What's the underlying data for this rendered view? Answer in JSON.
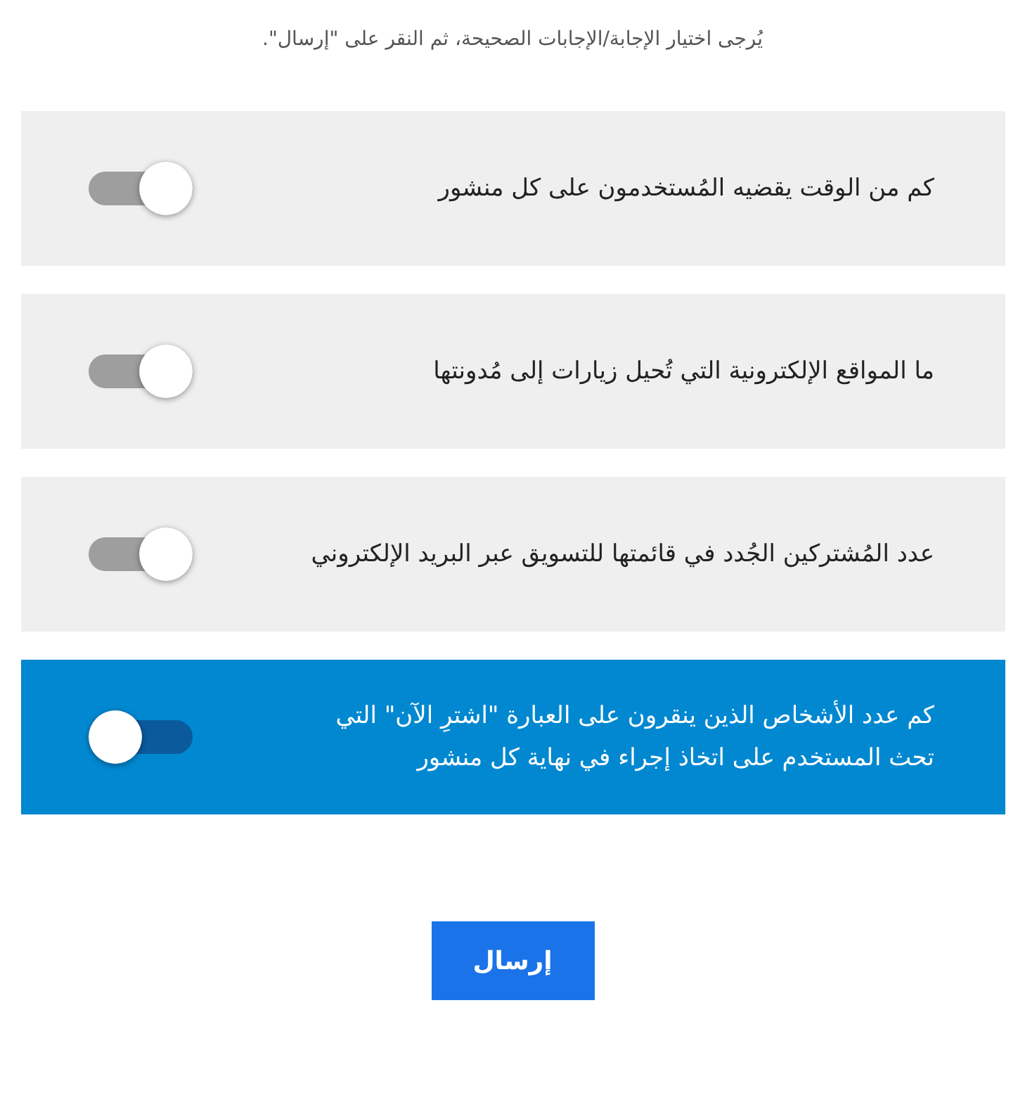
{
  "instruction": "يُرجى اختيار الإجابة/الإجابات الصحيحة، ثم النقر على \"إرسال\".",
  "options": [
    {
      "label": "كم من الوقت يقضيه المُستخدمون على كل منشور",
      "selected": false
    },
    {
      "label": "ما المواقع الإلكترونية التي تُحيل زيارات إلى مُدونتها",
      "selected": false
    },
    {
      "label": "عدد المُشتركين الجُدد في قائمتها للتسويق عبر البريد الإلكتروني",
      "selected": false
    },
    {
      "label": "كم عدد الأشخاص الذين ينقرون على العبارة \"اشترِ الآن\" التي تحث المستخدم على اتخاذ إجراء في نهاية كل منشور",
      "selected": true
    }
  ],
  "submit_button": "إرسال"
}
